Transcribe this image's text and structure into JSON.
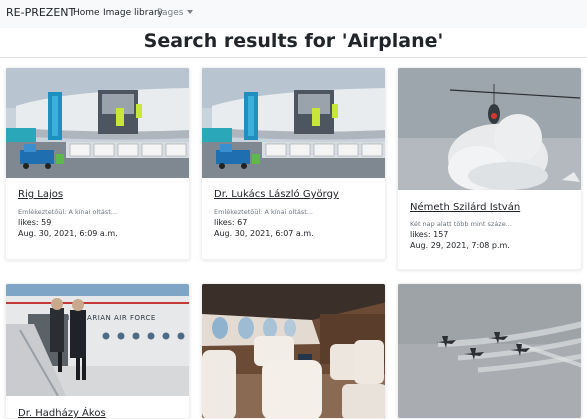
{
  "navbar": {
    "brand": "RE-PREZENT",
    "links": [
      "Home",
      "Image library",
      "Pages"
    ]
  },
  "page": {
    "title": "Search results for 'Airplane'"
  },
  "results": [
    {
      "name": "Rig Lajos",
      "description": "Emlékeztetőül: A kínai oltást...",
      "likes": "likes: 59",
      "date": "Aug. 30, 2021, 6:09 a.m.",
      "image": "cargo-plane-loading"
    },
    {
      "name": "Dr. Lukács László György",
      "description": "Emlékeztetőül: A kínai oltást...",
      "likes": "likes: 67",
      "date": "Aug. 30, 2021, 6:07 a.m.",
      "image": "cargo-plane-loading"
    },
    {
      "name": "Németh Szilárd István",
      "description": "Két nap alatt több mint száze...",
      "likes": "likes: 157",
      "date": "Aug. 29, 2021, 7:08 p.m.",
      "image": "helicopter-smoke"
    },
    {
      "name": "Dr. Hadházy Ákos",
      "image": "hungarian-air-force-stairs"
    },
    {
      "name": "",
      "image": "jet-cabin-interior"
    },
    {
      "name": "",
      "image": "jet-formation-smoke"
    }
  ],
  "colors": {
    "navbar_bg": "#f8f9fa",
    "text": "#212529",
    "muted": "#6c757d"
  }
}
